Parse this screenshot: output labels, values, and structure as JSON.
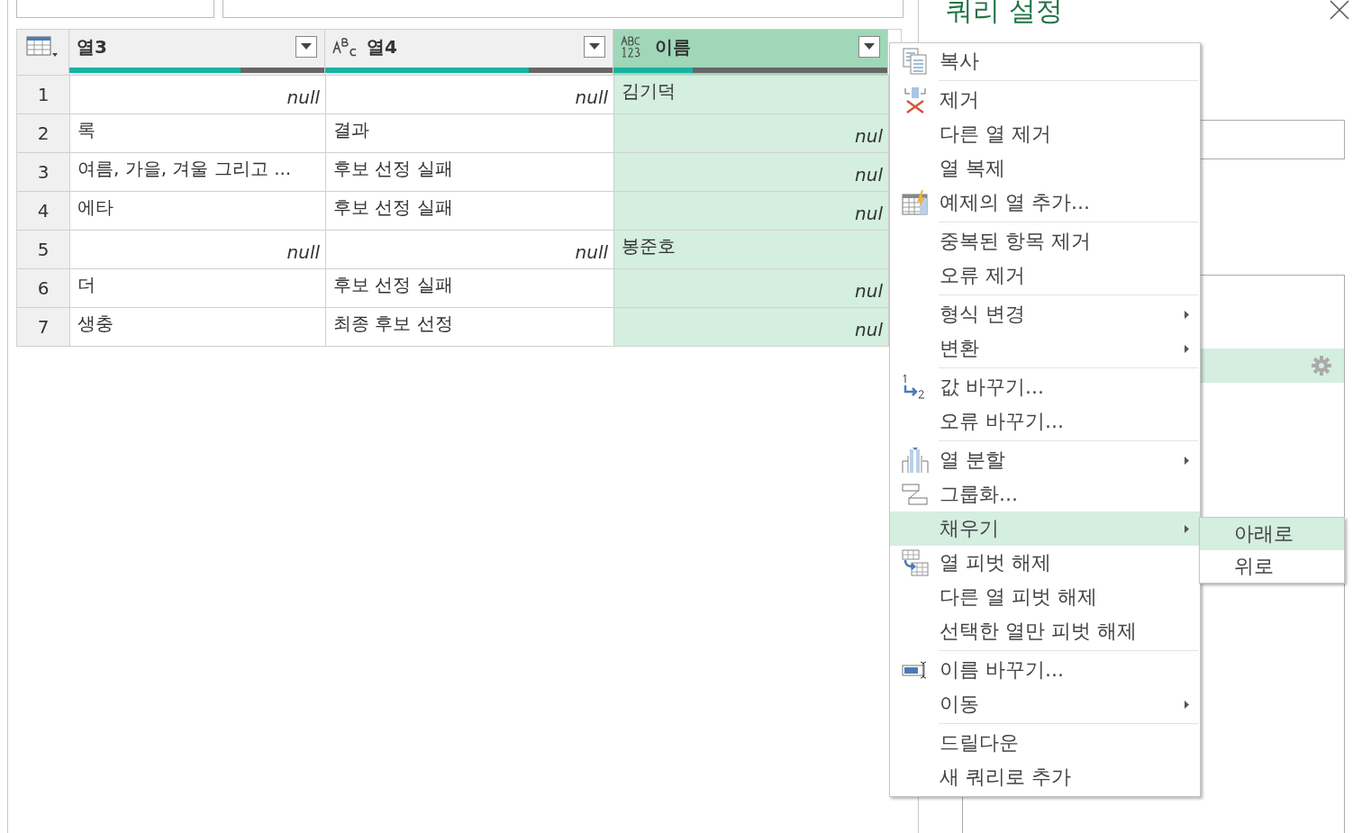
{
  "query_settings": {
    "title": "쿼리 설정"
  },
  "table": {
    "columns": [
      {
        "kind": "table",
        "label": "열3",
        "selected": false,
        "level": 0.67
      },
      {
        "kind": "text",
        "label": "열4",
        "selected": false,
        "level": 0.71
      },
      {
        "kind": "any",
        "label": "이름",
        "selected": true,
        "level": 0.29
      }
    ],
    "rows": [
      {
        "number": "1",
        "cells": [
          {
            "text": "null",
            "null": true
          },
          {
            "text": "null",
            "null": true
          },
          {
            "text": "김기덕",
            "null": false
          }
        ]
      },
      {
        "number": "2",
        "cells": [
          {
            "text": "록",
            "null": false
          },
          {
            "text": "결과",
            "null": false
          },
          {
            "text": "nul",
            "null": true
          }
        ]
      },
      {
        "number": "3",
        "cells": [
          {
            "text": "여름, 가을, 겨울 그리고 ...",
            "null": false
          },
          {
            "text": "후보 선정 실패",
            "null": false
          },
          {
            "text": "nul",
            "null": true
          }
        ]
      },
      {
        "number": "4",
        "cells": [
          {
            "text": "에타",
            "null": false
          },
          {
            "text": "후보 선정 실패",
            "null": false
          },
          {
            "text": "nul",
            "null": true
          }
        ]
      },
      {
        "number": "5",
        "cells": [
          {
            "text": "null",
            "null": true
          },
          {
            "text": "null",
            "null": true
          },
          {
            "text": "봉준호",
            "null": false
          }
        ]
      },
      {
        "number": "6",
        "cells": [
          {
            "text": "더",
            "null": false
          },
          {
            "text": "후보 선정 실패",
            "null": false
          },
          {
            "text": "nul",
            "null": true
          }
        ]
      },
      {
        "number": "7",
        "cells": [
          {
            "text": "생충",
            "null": false
          },
          {
            "text": "최종 후보 선정",
            "null": false
          },
          {
            "text": "nul",
            "null": true
          }
        ]
      }
    ]
  },
  "context_menu": {
    "groups": [
      [
        {
          "label": "복사",
          "submenu": false,
          "selected": false
        }
      ],
      [
        {
          "label": "제거",
          "submenu": false,
          "selected": false
        },
        {
          "label": "다른 열 제거",
          "submenu": false,
          "selected": false
        },
        {
          "label": "열 복제",
          "submenu": false,
          "selected": false
        },
        {
          "label": "예제의 열 추가...",
          "submenu": false,
          "selected": false
        }
      ],
      [
        {
          "label": "중복된 항목 제거",
          "submenu": false,
          "selected": false
        },
        {
          "label": "오류 제거",
          "submenu": false,
          "selected": false
        }
      ],
      [
        {
          "label": "형식 변경",
          "submenu": true,
          "selected": false
        },
        {
          "label": "변환",
          "submenu": true,
          "selected": false
        }
      ],
      [
        {
          "label": "값 바꾸기...",
          "submenu": false,
          "selected": false
        },
        {
          "label": "오류 바꾸기...",
          "submenu": false,
          "selected": false
        }
      ],
      [
        {
          "label": "열 분할",
          "submenu": true,
          "selected": false
        },
        {
          "label": "그룹화...",
          "submenu": false,
          "selected": false
        },
        {
          "label": "채우기",
          "submenu": true,
          "selected": true
        },
        {
          "label": "열 피벗 해제",
          "submenu": false,
          "selected": false
        },
        {
          "label": "다른 열 피벗 해제",
          "submenu": false,
          "selected": false
        },
        {
          "label": "선택한 열만 피벗 해제",
          "submenu": false,
          "selected": false
        }
      ],
      [
        {
          "label": "이름 바꾸기...",
          "submenu": false,
          "selected": false
        },
        {
          "label": "이동",
          "submenu": true,
          "selected": false
        }
      ],
      [
        {
          "label": "드릴다운",
          "submenu": false,
          "selected": false
        },
        {
          "label": "새 쿼리로 추가",
          "submenu": false,
          "selected": false
        }
      ]
    ]
  },
  "submenu": {
    "items": [
      {
        "label": "아래로",
        "selected": true
      },
      {
        "label": "위로",
        "selected": false
      }
    ]
  }
}
